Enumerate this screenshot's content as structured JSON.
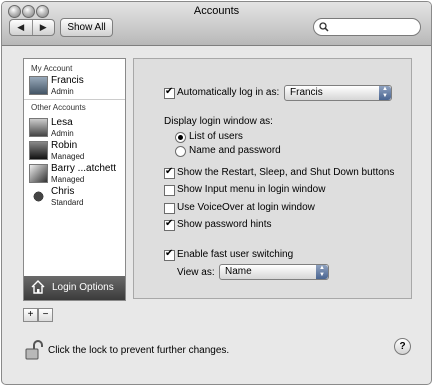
{
  "window": {
    "title": "Accounts"
  },
  "toolbar": {
    "back": "◀",
    "forward": "▶",
    "show_all": "Show All",
    "search_placeholder": ""
  },
  "sidebar": {
    "my_account_header": "My Account",
    "other_accounts_header": "Other Accounts",
    "my_account": {
      "name": "Francis",
      "role": "Admin"
    },
    "others": [
      {
        "name": "Lesa",
        "role": "Admin"
      },
      {
        "name": "Robin",
        "role": "Managed"
      },
      {
        "name": "Barry ...atchett",
        "role": "Managed"
      },
      {
        "name": "Chris",
        "role": "Standard"
      }
    ],
    "login_options": "Login Options",
    "add": "+",
    "remove": "−"
  },
  "options": {
    "auto_login_label": "Automatically log in as:",
    "auto_login_checked": true,
    "auto_login_user": "Francis",
    "display_label": "Display login window as:",
    "radio_list": "List of users",
    "radio_name": "Name and password",
    "radio_selected": "List of users",
    "show_restart": "Show the Restart, Sleep, and Shut Down buttons",
    "show_restart_checked": true,
    "show_input_menu": "Show Input menu in login window",
    "show_input_menu_checked": false,
    "voiceover": "Use VoiceOver at login window",
    "voiceover_checked": false,
    "password_hints": "Show password hints",
    "password_hints_checked": true,
    "fast_switch": "Enable fast user switching",
    "fast_switch_checked": true,
    "view_as_label": "View as:",
    "view_as_value": "Name"
  },
  "footer": {
    "lock_text": "Click the lock to prevent further changes.",
    "help": "?"
  }
}
